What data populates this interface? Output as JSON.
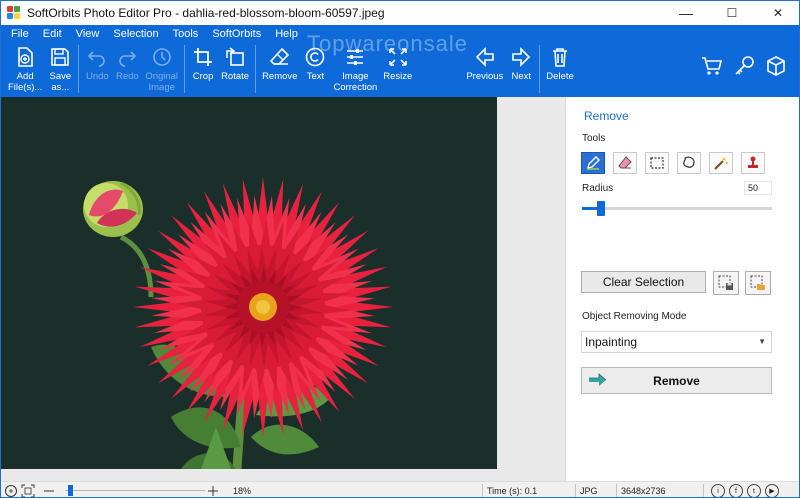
{
  "window": {
    "title": "SoftOrbits Photo Editor Pro - dahlia-red-blossom-bloom-60597.jpeg",
    "controls": {
      "minimize": "—",
      "maximize": "☐",
      "close": "✕"
    }
  },
  "menu": [
    "File",
    "Edit",
    "View",
    "Selection",
    "Tools",
    "SoftOrbits",
    "Help"
  ],
  "watermark": "Topwareonsale",
  "toolbar": {
    "add": "Add\nFile(s)...",
    "save": "Save\nas...",
    "undo": "Undo",
    "redo": "Redo",
    "original": "Original\nImage",
    "crop": "Crop",
    "rotate": "Rotate",
    "remove": "Remove",
    "text": "Text",
    "image_correction": "Image\nCorrection",
    "resize": "Resize",
    "previous": "Previous",
    "next": "Next",
    "delete": "Delete"
  },
  "panel": {
    "title": "Remove",
    "tools_label": "Tools",
    "radius_label": "Radius",
    "radius_value": "50",
    "radius_fraction": 0.1,
    "clear_selection": "Clear Selection",
    "mode_label": "Object Removing Mode",
    "mode_value": "Inpainting",
    "remove_button": "Remove"
  },
  "status": {
    "zoom": "18%",
    "time": "Time (s): 0.1",
    "format": "JPG",
    "dimensions": "3648x2736",
    "social_icons": [
      "info-icon",
      "facebook-icon",
      "twitter-icon",
      "youtube-icon"
    ]
  },
  "colors": {
    "ribbon": "#0e6ad8",
    "accent": "#1a6fc9",
    "canvas_bg": "#1a2e2a",
    "flower": "#e8213f"
  }
}
